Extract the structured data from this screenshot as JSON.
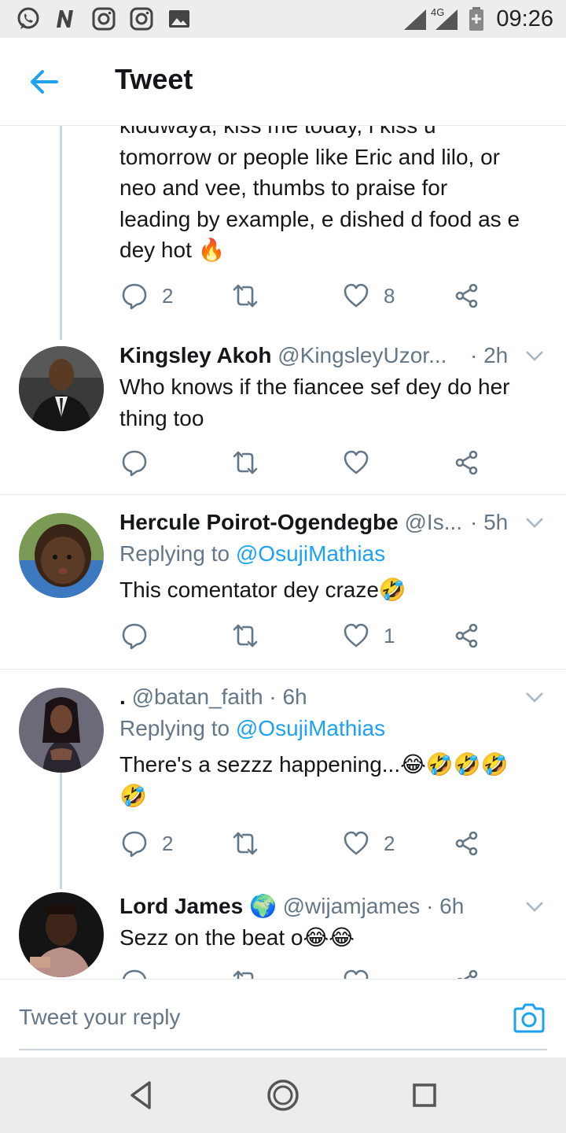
{
  "status_bar": {
    "time": "09:26",
    "network": "4G",
    "left_icons": [
      "whatsapp-icon",
      "n-app-icon",
      "instagram-icon",
      "instagram-icon",
      "gallery-icon"
    ]
  },
  "header": {
    "title": "Tweet"
  },
  "tweets": [
    {
      "text_lines": [
        "kiddwaya, kiss me today, i kiss u",
        "tomorrow or people like Eric and lilo, or",
        "neo and vee, thumbs to praise for",
        "leading by example, e dished d food as e",
        "dey hot 🔥"
      ],
      "replies": "2",
      "retweets": "",
      "likes": "8"
    },
    {
      "name": "Kingsley Akoh",
      "handle": "@KingsleyUzor...",
      "time": "· 2h",
      "text_lines": [
        "Who knows if the fiancee sef dey do her",
        "thing too"
      ],
      "replies": "",
      "retweets": "",
      "likes": ""
    },
    {
      "name": "Hercule Poirot-Ogendegbe",
      "handle": "@Is...",
      "time": "· 5h",
      "replying_label": "Replying to",
      "replying_to": "@OsujiMathias",
      "text_lines": [
        "This comentator dey craze🤣"
      ],
      "replies": "",
      "retweets": "",
      "likes": "1"
    },
    {
      "name": ".",
      "handle": "@batan_faith",
      "time": "· 6h",
      "replying_label": "Replying to",
      "replying_to": "@OsujiMathias",
      "text_lines": [
        "There's a sezzz happening...😂🤣🤣🤣",
        "🤣"
      ],
      "replies": "2",
      "retweets": "",
      "likes": "2"
    },
    {
      "name": "Lord James",
      "badge": "🌍",
      "handle": "@wijamjames",
      "time": "· 6h",
      "text_lines": [
        "Sezz on the beat o😂😂"
      ]
    }
  ],
  "composer": {
    "placeholder": "Tweet your reply"
  },
  "colors": {
    "accent": "#1da1f2",
    "muted": "#657786",
    "text": "#14171a"
  }
}
